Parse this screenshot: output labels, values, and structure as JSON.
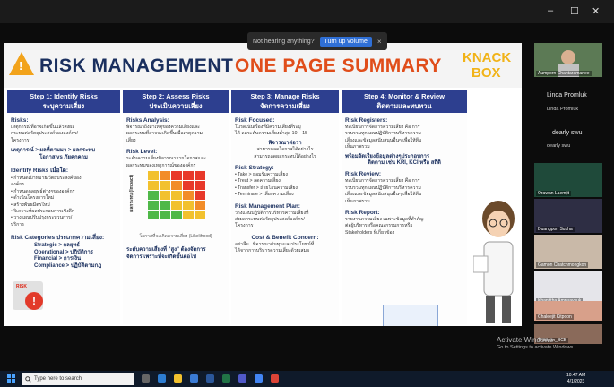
{
  "window": {
    "minimize": "–",
    "maximize": "☐",
    "close": "✕"
  },
  "banner": {
    "text": "Not hearing anything?",
    "button": "Turn up volume",
    "close": "×"
  },
  "slide": {
    "title_part1": "RISK MANAGEMENT",
    "title_part2": "ONE PAGE SUMMARY",
    "logo_line1": "KNACK",
    "logo_line2": "BOX",
    "steps": [
      {
        "header": "Step 1: Identify Risks",
        "header_sub": "ระบุความเสี่ยง",
        "sections": [
          {
            "title": "Risks:",
            "lines": [
              "เหตุการณ์ที่อาจเกิดขึ้นแล้วส่งผล",
              "กระทบต่อวัตถุประสงค์ขององค์กร/",
              "โครงการ"
            ]
          },
          {
            "title": "",
            "lines": [
              "เหตุการณ์ > ผลที่ตามมา > ผลกระทบ",
              "โอกาส vs ภัยคุกคาม"
            ]
          },
          {
            "title": "Identify Risks เมื่อใด:",
            "lines": [
              "• กำหนดเป้าหมาย/วัตถุประสงค์ของ",
              "  องค์กร",
              "• กำหนดกลยุทธ์ต่างๆขององค์กร",
              "• ดำเนินโครงการใหม่",
              "• สร้างพันธมิตรใหม่",
              "• วิเคราะห์ผลประกอบการเชิงลึก",
              "• วางแผนปรับปรุงกระบวนการ/",
              "  บริการ"
            ]
          },
          {
            "title": "Risk Categories ประเภทความเสี่ยง:",
            "lines": [
              "Strategic > กลยุทธ์",
              "Operational > ปฏิบัติการ",
              "Financial > การเงิน",
              "Compliance > ปฏิบัติตามกฎ"
            ]
          }
        ]
      },
      {
        "header": "Step 2: Assess Risks",
        "header_sub": "ประเมินความเสี่ยง",
        "sections": [
          {
            "title": "Risks Analysis:",
            "lines": [
              "พิจารณาถึงสาเหตุของความเสี่ยงและ",
              "ผลกระทบที่อาจจะเกิดขึ้นเมื่อเหตุความ",
              "เสี่ยง"
            ]
          },
          {
            "title": "Risk Level:",
            "lines": [
              "ระดับความเสี่ยงพิจารณาจากโอกาสและ",
              "ผลกระทบของเหตุการณ์ขององค์กร"
            ]
          },
          {
            "title": "",
            "lines": [
              "โอกาสที่จะเกิดความเสี่ยง (Likelihood)"
            ]
          },
          {
            "title": "",
            "lines": [
              "ระดับความเสี่ยงที่ \"สูง\" ต้องจัดการ",
              "จัดการ เพราะที่จะเกิดขึ้นต่อไป"
            ]
          }
        ],
        "matrix_axis_label": "ผลกระทบ (Impact)"
      },
      {
        "header": "Step 3: Manage Risks",
        "header_sub": "จัดการความเสี่ยง",
        "sections": [
          {
            "title": "Risk Focused:",
            "lines": [
              "โปรดเน้นเรื่องที่มีความเสี่ยงที่ระบุ",
              "ได้ ลดระดับความเสี่ยงต่ำสุด 10 – 15"
            ]
          },
          {
            "title": "",
            "lines": [
              "พิจารณาต่อว่า",
              "สามารถลดโอกาสได้อย่างไร",
              "สามารถลดผลกระทบได้อย่างไร"
            ]
          },
          {
            "title": "Risk Strategy:",
            "lines": [
              "• Take > ยอมรับความเสี่ยง",
              "• Treat > ลดความเสี่ยง",
              "• Transfer > ถ่ายโอนความเสี่ยง",
              "• Terminate > เลี่ยงความเสี่ยง"
            ]
          },
          {
            "title": "Risk Management Plan:",
            "lines": [
              "วางแผนปฏิบัติการบริหารความเสี่ยงที่",
              "ส่งผลกระทบต่อวัตถุประสงค์องค์กร/",
              "โครงการ"
            ]
          },
          {
            "title": "Cost & Benefit Concern:",
            "lines": [
              "อย่าลืม...พิจารณาต้นทุนและประโยชน์ที่",
              "ได้จากการบริหารความเสี่ยงด้วยเสมอ"
            ]
          }
        ]
      },
      {
        "header": "Step 4: Monitor & Review",
        "header_sub": "ติดตามและทบทวน",
        "sections": [
          {
            "title": "Risk Registers:",
            "lines": [
              "ทะเบียนการจัดการความเสี่ยง คือ การ",
              "รวบรวมทุกแผนปฏิบัติการบริหารความ",
              "เสี่ยงและข้อมูลสนับสนุนอื่นๆ เพื่อให้ทีม",
              "เห็นภาพรวม"
            ]
          },
          {
            "title": "",
            "lines": [
              "พร้อมจัดเรียงข้อมูลต่างๆประกอบการ",
              "ติดตาม เช่น KRI, KCI หรือ สถิติ"
            ]
          },
          {
            "title": "Risk Review:",
            "lines": [
              "ทะเบียนการจัดการความเสี่ยง คือ การ",
              "รวบรวมทุกแผนปฏิบัติการบริหารความ",
              "เสี่ยงและข้อมูลสนับสนุนอื่นๆ เพื่อให้ทีม",
              "เห็นภาพรวม"
            ]
          },
          {
            "title": "Risk Report:",
            "lines": [
              "รายงานความเสี่ยง เฉพาะข้อมูลที่สำคัญ",
              "ต่อผู้บริหารหรือคณะกรรมการหรือ",
              "Stakeholders ที่เกี่ยวข้อง"
            ]
          }
        ]
      }
    ],
    "risk_sign": "RISK",
    "risk_sign_symbol": "!"
  },
  "participants": [
    {
      "tile_label": "Aumporn Chantaramanee"
    },
    {
      "name": "Linda Promluk",
      "sub": "Linda Promluk"
    },
    {
      "name": "dearly swu",
      "sub": "dearly swu"
    },
    {
      "tile_label": "Orawan Laemjit"
    },
    {
      "tile_label": "Duangpon Sukha"
    },
    {
      "tile_label": "Gamon Chatchmongkon"
    },
    {
      "tile_label": "Khanittha Amnuaysuk"
    },
    {
      "tile_label": "Chaleejit Kitpoon"
    },
    {
      "tile_label": "Thitikarn_BCB"
    }
  ],
  "activate": {
    "line1": "Activate Windows",
    "line2": "Go to Settings to activate Windows."
  },
  "taskbar": {
    "search_placeholder": "Type here to search",
    "time": "10:47 AM",
    "date": "4/1/2023"
  }
}
